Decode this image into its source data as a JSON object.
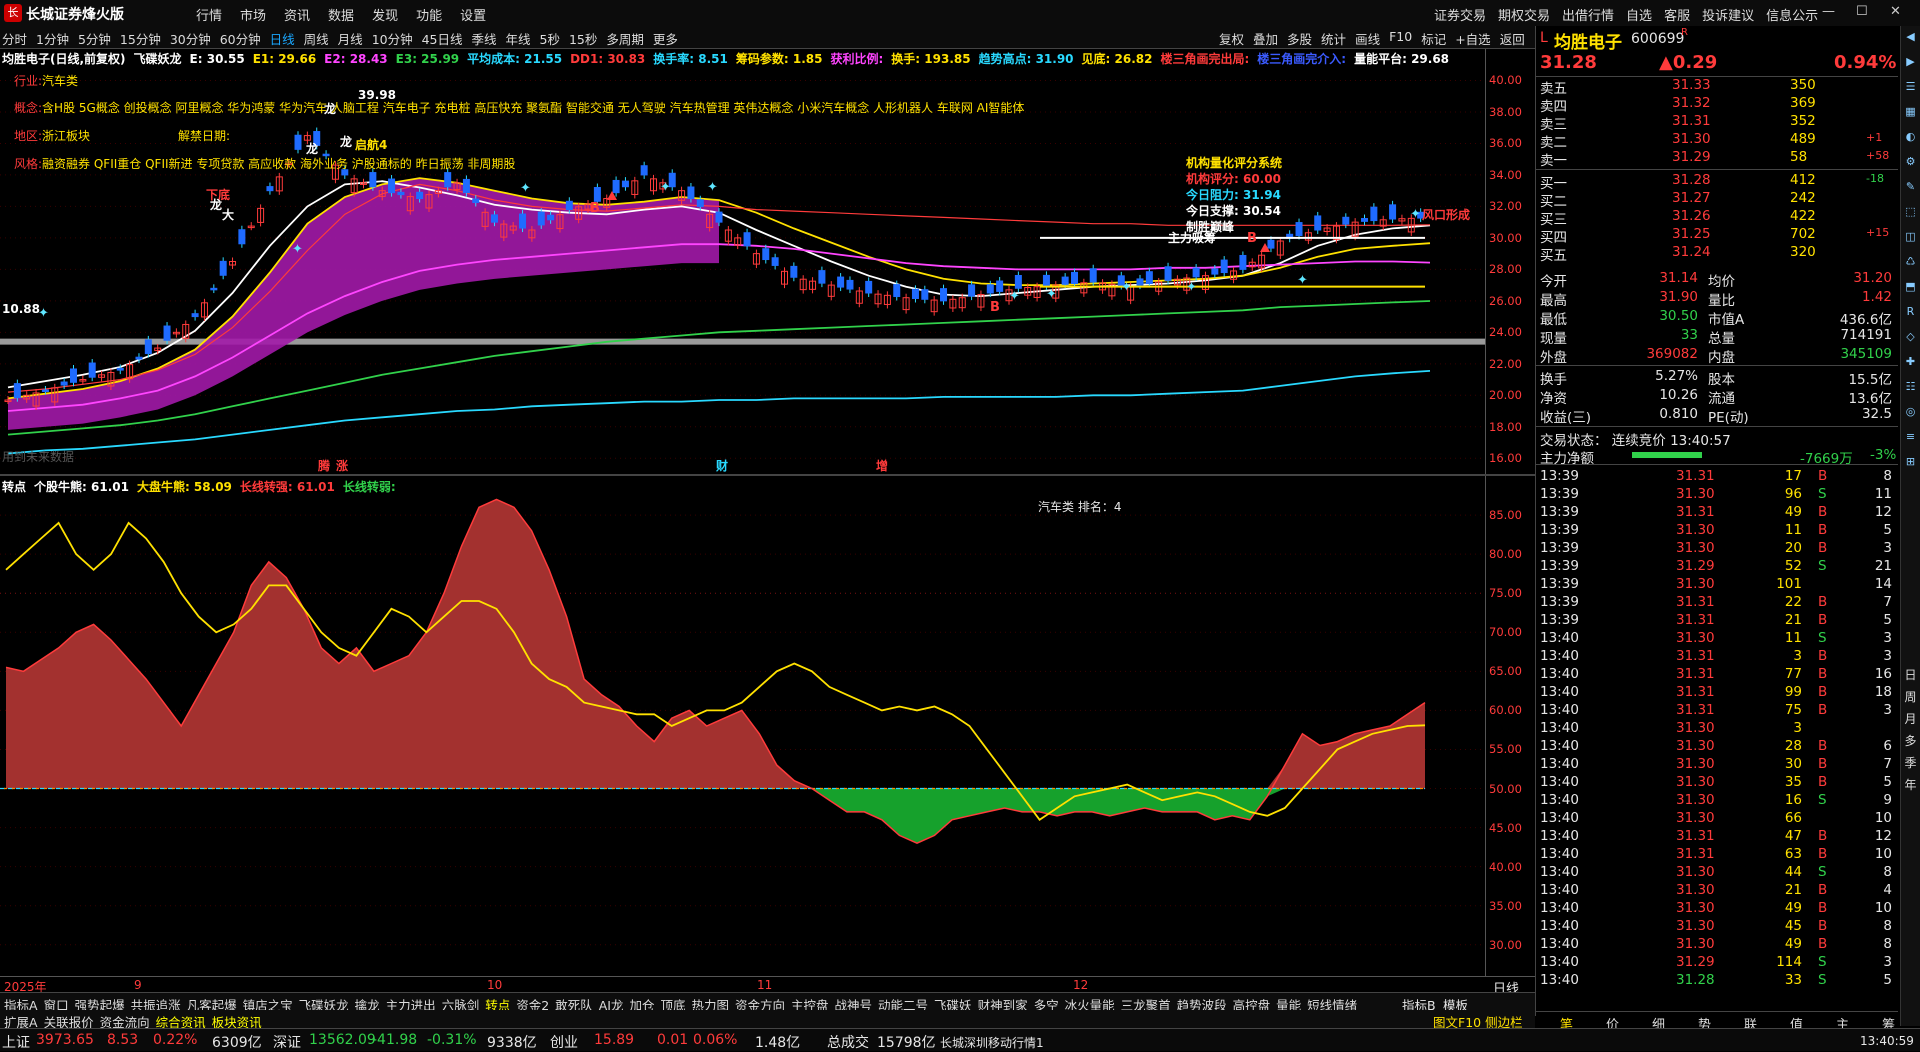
{
  "app": {
    "title": "长城证券烽火版",
    "menu": [
      "行情",
      "市场",
      "资讯",
      "数据",
      "发现",
      "功能",
      "设置"
    ],
    "right_menu": [
      "证券交易",
      "期权交易",
      "出借行情",
      "自选",
      "客服",
      "投诉建议",
      "信息公示"
    ]
  },
  "toolbar": {
    "periods": [
      "分时",
      "1分钟",
      "5分钟",
      "15分钟",
      "30分钟",
      "60分钟",
      "日线",
      "周线",
      "月线",
      "10分钟",
      "45日线",
      "季线",
      "年线",
      "5秒",
      "15秒",
      "多周期",
      "更多"
    ],
    "active_period": "日线",
    "tools": [
      "复权",
      "叠加",
      "多股",
      "统计",
      "画线",
      "F10",
      "标记",
      "+自选",
      "返回"
    ]
  },
  "main": {
    "indicator_line": [
      {
        "t": "均胜电子(日线,前复权)",
        "c": "#ffffff"
      },
      {
        "t": "飞碟妖龙",
        "c": "#ffffff"
      },
      {
        "t": "E: 30.55",
        "c": "#ffffff"
      },
      {
        "t": "E1: 29.66",
        "c": "#ffe100"
      },
      {
        "t": "E2: 28.43",
        "c": "#ff45ff"
      },
      {
        "t": "E3: 25.99",
        "c": "#31d14b"
      },
      {
        "t": "平均成本: 21.55",
        "c": "#29d9ff"
      },
      {
        "t": "DD1: 30.83",
        "c": "#ff3b3b"
      },
      {
        "t": "换手率: 8.51",
        "c": "#29d9ff"
      },
      {
        "t": "筹码参数: 1.85",
        "c": "#ffe100"
      },
      {
        "t": "获利比例:",
        "c": "#ff45ff"
      },
      {
        "t": "换手: 193.85",
        "c": "#ffe100"
      },
      {
        "t": "趋势高点: 31.90",
        "c": "#29d9ff"
      },
      {
        "t": "见底: 26.82",
        "c": "#ffe100"
      },
      {
        "t": "楼三角画完出局:",
        "c": "#ff3b3b"
      },
      {
        "t": "楼三角画完介入:",
        "c": "#3b5bff"
      },
      {
        "t": "量能平台: 29.68",
        "c": "#ffffff"
      }
    ],
    "industry_label": "行业:",
    "industry": "汽车类",
    "concept_label": "概念:",
    "concepts": "含H股 5G概念 创投概念 阿里概念 华为鸿蒙 华为汽车 人脑工程 汽车电子 充电桩 高压快充 聚氨酯 智能交通 无人驾驶 汽车热管理 英伟达概念 小米汽车概念 人形机器人 车联网 AI智能体",
    "region_label": "地区:",
    "region": "浙江板块",
    "unlock_label": "解禁日期:",
    "style_label": "风格:",
    "styles": "融资融券 QFII重仓 QFII新进 专项贷款 高应收款 海外业务 沪股通标的 昨日振荡 非周期股",
    "score_title": "机构量化评分系统",
    "score_rows": [
      {
        "t": "机构评分:  60.00",
        "c": "#ff3b3b"
      },
      {
        "t": "今日阻力:  31.94",
        "c": "#29d9ff"
      },
      {
        "t": "今日支撑:  30.54",
        "c": "#ffffff"
      },
      {
        "t": "制胜巅峰",
        "c": "#ffffff"
      }
    ],
    "marks": {
      "dragon": "龙",
      "start": "启航4",
      "high_price": "39.98",
      "low_price": "10.88",
      "zhuli": "主力吸筹",
      "fengkou": "风口形成",
      "buy": "B",
      "buy_big": "大",
      "xiadi": "下底"
    },
    "bottom_marks": [
      "腾",
      "涨",
      "财",
      "增"
    ],
    "future_label": "用到未来数据"
  },
  "axis_main": [
    "40.00",
    "38.00",
    "36.00",
    "34.00",
    "32.00",
    "30.00",
    "28.00",
    "26.00",
    "24.00",
    "22.00",
    "20.00",
    "18.00",
    "16.00"
  ],
  "axis_sub": [
    "85.00",
    "80.00",
    "75.00",
    "70.00",
    "65.00",
    "60.00",
    "55.00",
    "50.00",
    "45.00",
    "40.00",
    "35.00",
    "30.00"
  ],
  "sub": {
    "indicator_line": [
      {
        "t": "转点",
        "c": "#ffffff"
      },
      {
        "t": "个股牛熊: 61.01",
        "c": "#ffffff"
      },
      {
        "t": "大盘牛熊: 58.09",
        "c": "#ffe100"
      },
      {
        "t": "长线转强: 61.01",
        "c": "#ff3b3b"
      },
      {
        "t": "长线转弱:",
        "c": "#31d14b"
      }
    ],
    "rank_label": "汽车类    排名：4"
  },
  "xaxis": {
    "labels": [
      "2025年",
      "9",
      "10",
      "11",
      "12"
    ],
    "period": "日线"
  },
  "quote": {
    "name": "均胜电子",
    "code": "600699",
    "tag": "R",
    "price": "31.28",
    "change": "▲0.29",
    "pct": "0.94%",
    "asks": [
      {
        "l": "卖五",
        "p": "31.33",
        "v": "350",
        "d": ""
      },
      {
        "l": "卖四",
        "p": "31.32",
        "v": "369",
        "d": ""
      },
      {
        "l": "卖三",
        "p": "31.31",
        "v": "352",
        "d": ""
      },
      {
        "l": "卖二",
        "p": "31.30",
        "v": "489",
        "d": "+1"
      },
      {
        "l": "卖一",
        "p": "31.29",
        "v": "58",
        "d": "+58"
      }
    ],
    "bids": [
      {
        "l": "买一",
        "p": "31.28",
        "v": "412",
        "d": "-18"
      },
      {
        "l": "买二",
        "p": "31.27",
        "v": "242",
        "d": ""
      },
      {
        "l": "买三",
        "p": "31.26",
        "v": "422",
        "d": ""
      },
      {
        "l": "买四",
        "p": "31.25",
        "v": "702",
        "d": "+15"
      },
      {
        "l": "买五",
        "p": "31.24",
        "v": "320",
        "d": ""
      }
    ],
    "stats": [
      {
        "l1": "今开",
        "v1": "31.14",
        "c1": "#ff3b3b",
        "l2": "均价",
        "v2": "31.20",
        "c2": "#ff3b3b"
      },
      {
        "l1": "最高",
        "v1": "31.90",
        "c1": "#ff3b3b",
        "l2": "量比",
        "v2": "1.42",
        "c2": "#ff3b3b"
      },
      {
        "l1": "最低",
        "v1": "30.50",
        "c1": "#31d14b",
        "l2": "市值A",
        "v2": "436.6亿",
        "c2": "#e6e6e6"
      },
      {
        "l1": "现量",
        "v1": "33",
        "c1": "#31d14b",
        "l2": "总量",
        "v2": "714191",
        "c2": "#e6e6e6"
      },
      {
        "l1": "外盘",
        "v1": "369082",
        "c1": "#ff3b3b",
        "l2": "内盘",
        "v2": "345109",
        "c2": "#31d14b"
      }
    ],
    "stats2": [
      {
        "l1": "换手",
        "v1": "5.27%",
        "l2": "股本",
        "v2": "15.5亿"
      },
      {
        "l1": "净资",
        "v1": "10.26",
        "l2": "流通",
        "v2": "13.6亿"
      },
      {
        "l1": "收益(三)",
        "v1": "0.810",
        "l2": "PE(动)",
        "v2": "32.5"
      }
    ],
    "trade_status": "交易状态：  连续竞价  13:40:57",
    "main_net_label": "主力净额",
    "main_net": "-7669万",
    "main_net_pct": "-3%"
  },
  "ticks": [
    [
      "13:39",
      "31.31",
      "17",
      "B",
      "8"
    ],
    [
      "13:39",
      "31.30",
      "96",
      "S",
      "11"
    ],
    [
      "13:39",
      "31.31",
      "49",
      "B",
      "12"
    ],
    [
      "13:39",
      "31.30",
      "11",
      "B",
      "5"
    ],
    [
      "13:39",
      "31.30",
      "20",
      "B",
      "3"
    ],
    [
      "13:39",
      "31.29",
      "52",
      "S",
      "21"
    ],
    [
      "13:39",
      "31.30",
      "101",
      "",
      "14"
    ],
    [
      "13:39",
      "31.31",
      "22",
      "B",
      "7"
    ],
    [
      "13:39",
      "31.31",
      "21",
      "B",
      "5"
    ],
    [
      "13:40",
      "31.30",
      "11",
      "S",
      "3"
    ],
    [
      "13:40",
      "31.31",
      "3",
      "B",
      "3"
    ],
    [
      "13:40",
      "31.31",
      "77",
      "B",
      "16"
    ],
    [
      "13:40",
      "31.31",
      "99",
      "B",
      "18"
    ],
    [
      "13:40",
      "31.31",
      "75",
      "B",
      "3"
    ],
    [
      "13:40",
      "31.30",
      "3",
      "",
      ""
    ],
    [
      "13:40",
      "31.30",
      "28",
      "B",
      "6"
    ],
    [
      "13:40",
      "31.30",
      "30",
      "B",
      "7"
    ],
    [
      "13:40",
      "31.30",
      "35",
      "B",
      "5"
    ],
    [
      "13:40",
      "31.30",
      "16",
      "S",
      "9"
    ],
    [
      "13:40",
      "31.30",
      "66",
      "",
      "10"
    ],
    [
      "13:40",
      "31.31",
      "47",
      "B",
      "12"
    ],
    [
      "13:40",
      "31.31",
      "63",
      "B",
      "10"
    ],
    [
      "13:40",
      "31.30",
      "44",
      "S",
      "8"
    ],
    [
      "13:40",
      "31.30",
      "21",
      "B",
      "4"
    ],
    [
      "13:40",
      "31.30",
      "49",
      "B",
      "10"
    ],
    [
      "13:40",
      "31.30",
      "45",
      "B",
      "8"
    ],
    [
      "13:40",
      "31.30",
      "49",
      "B",
      "8"
    ],
    [
      "13:40",
      "31.29",
      "114",
      "S",
      "3"
    ],
    [
      "13:40",
      "31.28",
      "33",
      "S",
      "5"
    ]
  ],
  "rp_tabs": [
    "笔",
    "价",
    "细",
    "势",
    "联",
    "值",
    "主",
    "筹"
  ],
  "sidebar_labels": [
    "日",
    "周",
    "月",
    "多",
    "季",
    "年"
  ],
  "bottom_tabs1": [
    "指标A",
    "窗口",
    "强势起爆",
    "共振追涨",
    "凡客起爆",
    "镇店之宝",
    "飞碟妖龙",
    "擒龙",
    "主力进出",
    "六脉剑",
    "转点",
    "资金2",
    "敢死队",
    "AI龙",
    "加仓",
    "顶底",
    "热力图",
    "资金方向",
    "主控盘",
    "战神号",
    "动能二号",
    "飞碟妖",
    "财神到家",
    "多空",
    "冰火量能",
    "三龙聚首",
    "趋势波段",
    "高控盘",
    "量能",
    "短线情绪"
  ],
  "bottom_tabs1_active": "转点",
  "bottom_tabs2": [
    "扩展A",
    "关联报价",
    "资金流向",
    "综合资讯",
    "板块资讯"
  ],
  "bottom_tabs2_active": [
    "综合资讯",
    "板块资讯"
  ],
  "bottom_right": {
    "b1": "指标B",
    "b2": "模板",
    "f10": "图文F10 侧边栏"
  },
  "status": {
    "sh_label": "上证",
    "sh": "3973.65",
    "sh_chg": "8.53",
    "sh_pct": "0.22%",
    "sh_amt": "6309亿",
    "sz_label": "深证",
    "sz": "13562.09",
    "sz_chg": "-41.98",
    "sz_pct": "-0.31%",
    "sz_amt": "9338亿",
    "cy_label": "创业",
    "cy": "15.89",
    "cy_chg": "0.01",
    "cy_pct": "0.06%",
    "cy_amt": "1.48亿",
    "total_label": "总成交",
    "total": "15798亿",
    "server": "长城深圳移动行情1",
    "time": "13:40:59"
  },
  "chart_data": [
    {
      "type": "candlestick",
      "title": "均胜电子(日线,前复权)",
      "ylim": [
        15,
        42
      ],
      "y_ticks": [
        16,
        18,
        20,
        22,
        24,
        26,
        28,
        30,
        32,
        34,
        36,
        38,
        40
      ],
      "x_labels": [
        "2025年",
        "9",
        "10",
        "11",
        "12"
      ],
      "series": [
        {
          "name": "E",
          "color": "#ffffff",
          "values": [
            20.5,
            20.9,
            21.3,
            21.8,
            22.7,
            24.1,
            26.5,
            29.5,
            32.0,
            33.4,
            33.6,
            33.2,
            32.7,
            32.1,
            31.8,
            31.6,
            31.5,
            31.8,
            32.0,
            31.6,
            30.5,
            29.5,
            28.5,
            27.6,
            26.9,
            26.4,
            26.3,
            26.5,
            26.7,
            26.9,
            27.0,
            27.1,
            27.3,
            27.6,
            28.4,
            29.5,
            30.2,
            30.6,
            30.8
          ]
        },
        {
          "name": "E1",
          "color": "#ffe100",
          "values": [
            19.8,
            20.1,
            20.4,
            20.9,
            21.7,
            22.9,
            25.0,
            27.8,
            30.9,
            32.6,
            33.4,
            33.8,
            33.5,
            33.0,
            32.5,
            32.2,
            32.1,
            32.3,
            32.6,
            32.4,
            31.6,
            30.6,
            29.7,
            28.8,
            28.0,
            27.4,
            27.1,
            27.0,
            27.0,
            27.1,
            27.2,
            27.3,
            27.4,
            27.6,
            28.1,
            28.8,
            29.3,
            29.5,
            29.66
          ]
        },
        {
          "name": "E2",
          "color": "#ff45ff",
          "values": [
            19.0,
            19.2,
            19.4,
            19.8,
            20.3,
            21.2,
            22.4,
            23.8,
            25.2,
            26.3,
            27.2,
            27.9,
            28.3,
            28.6,
            28.8,
            29.0,
            29.2,
            29.4,
            29.6,
            29.6,
            29.5,
            29.3,
            29.0,
            28.7,
            28.4,
            28.2,
            28.1,
            28.0,
            28.0,
            28.0,
            28.0,
            28.1,
            28.1,
            28.2,
            28.3,
            28.4,
            28.5,
            28.5,
            28.43
          ]
        },
        {
          "name": "E3",
          "color": "#31d14b",
          "values": [
            17.5,
            17.7,
            17.9,
            18.1,
            18.4,
            18.8,
            19.3,
            19.8,
            20.3,
            20.8,
            21.3,
            21.7,
            22.1,
            22.5,
            22.8,
            23.1,
            23.4,
            23.6,
            23.8,
            24.0,
            24.1,
            24.2,
            24.3,
            24.4,
            24.5,
            24.6,
            24.7,
            24.8,
            24.9,
            25.0,
            25.1,
            25.2,
            25.3,
            25.4,
            25.6,
            25.7,
            25.8,
            25.9,
            25.99
          ]
        },
        {
          "name": "平均成本",
          "color": "#29d9ff",
          "values": [
            16.3,
            16.5,
            16.6,
            16.8,
            17.0,
            17.2,
            17.5,
            17.8,
            18.1,
            18.4,
            18.6,
            18.8,
            19.0,
            19.1,
            19.3,
            19.4,
            19.5,
            19.6,
            19.6,
            19.7,
            19.7,
            19.8,
            19.8,
            19.8,
            19.8,
            19.9,
            19.9,
            19.9,
            19.9,
            20.0,
            20.0,
            20.1,
            20.2,
            20.3,
            20.6,
            20.9,
            21.2,
            21.4,
            21.55
          ]
        },
        {
          "name": "DD1",
          "color": "#ff3b3b",
          "values": [
            20.2,
            20.4,
            20.7,
            21.0,
            21.6,
            22.6,
            24.3,
            26.6,
            29.2,
            31.5,
            32.8,
            33.4,
            33.0,
            32.4,
            32.0,
            31.8,
            31.7,
            31.9,
            32.1,
            32.0,
            31.8,
            31.7,
            31.6,
            31.5,
            31.4,
            31.3,
            31.2,
            31.1,
            31.0,
            30.9,
            30.9,
            30.8,
            30.8,
            30.8,
            30.8,
            30.8,
            30.8,
            30.8,
            30.83
          ]
        }
      ],
      "closes": [
        19.7,
        20.3,
        21.0,
        21.6,
        23.0,
        25.0,
        28.5,
        33.0,
        36.5,
        34.0,
        33.0,
        32.5,
        33.5,
        31.0,
        30.5,
        31.8,
        32.5,
        34.0,
        33.0,
        31.0,
        29.0,
        27.5,
        27.0,
        26.5,
        26.2,
        26.0,
        26.4,
        26.8,
        27.0,
        27.2,
        26.9,
        27.3,
        27.6,
        28.0,
        29.8,
        30.5,
        31.0,
        31.2,
        31.28
      ]
    },
    {
      "type": "area",
      "title": "转点",
      "ylim": [
        26,
        90
      ],
      "y_ticks": [
        30,
        35,
        40,
        45,
        50,
        55,
        60,
        65,
        70,
        75,
        80,
        85
      ],
      "baseline": 50,
      "series": [
        {
          "name": "个股牛熊",
          "color": "#ff3b3b",
          "values": [
            65.5,
            65,
            66.5,
            68,
            70,
            71,
            69,
            66.5,
            64,
            61,
            58,
            62,
            66,
            70,
            76,
            79,
            77,
            73,
            68,
            66,
            68,
            65,
            66,
            67,
            70,
            75,
            81,
            86,
            87,
            86,
            83,
            78,
            72,
            64,
            62,
            60.5,
            58,
            56,
            59,
            60,
            58,
            59,
            60,
            57,
            53,
            51,
            50,
            48.5,
            47,
            47,
            46,
            44,
            43,
            44,
            46,
            46.5,
            47,
            47.5,
            47,
            47,
            46.5,
            47,
            47,
            46.5,
            47,
            47.5,
            47,
            47,
            47,
            46,
            46.5,
            46,
            49,
            53,
            57,
            55.5,
            56,
            57,
            57.5,
            58,
            59.5,
            61
          ]
        },
        {
          "name": "大盘牛熊",
          "color": "#ffe100",
          "values": [
            78,
            80,
            82,
            84,
            80,
            78,
            80,
            84,
            82,
            79,
            75,
            72,
            70,
            71,
            73,
            76,
            76,
            73,
            70,
            68,
            67,
            70,
            73,
            72,
            70,
            72,
            74,
            74,
            73,
            70,
            66,
            64,
            63,
            61,
            60.5,
            60,
            59.5,
            59.5,
            58,
            59,
            60,
            60,
            61,
            63,
            65,
            66,
            65,
            63,
            62,
            61,
            60,
            60.5,
            60,
            60.5,
            59.5,
            58,
            55,
            52,
            49,
            46,
            47.5,
            49,
            49.5,
            50,
            50.5,
            49.5,
            48.5,
            49,
            49.5,
            49,
            48,
            47,
            46.5,
            47.5,
            50,
            52.5,
            55,
            56,
            57,
            57.5,
            58,
            58.09
          ]
        }
      ]
    }
  ]
}
